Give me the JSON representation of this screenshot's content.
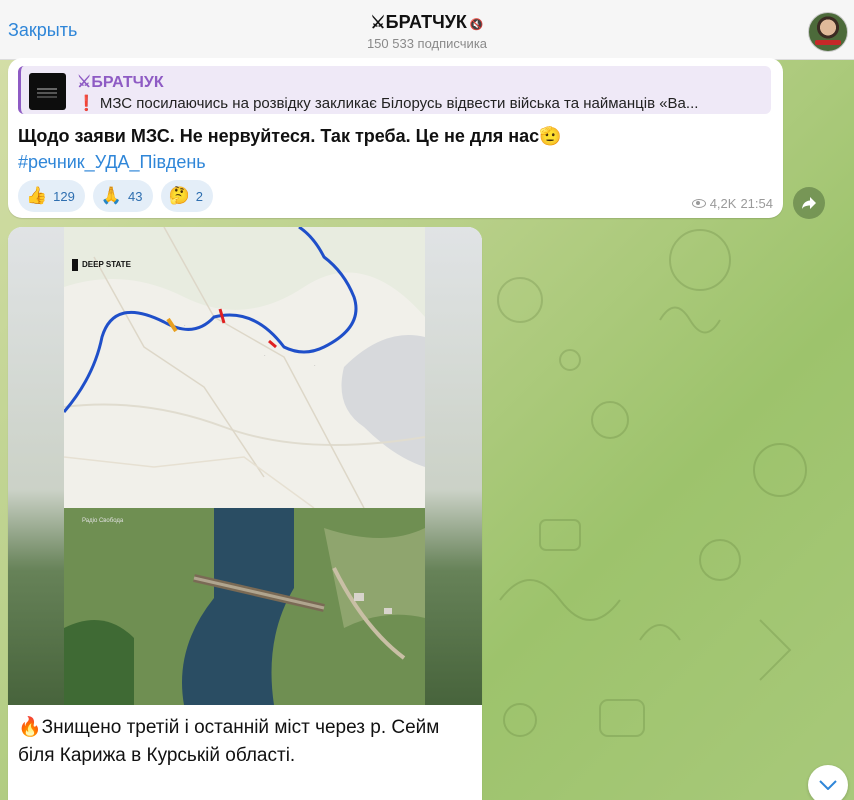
{
  "header": {
    "close_label": "Закрыть",
    "channel_name": "БРАТЧУК",
    "channel_prefix_icon": "crossed-swords-icon",
    "muted_icon": "muted-speaker-icon",
    "subscribers": "150 533 подписчика"
  },
  "message1": {
    "reply": {
      "name": "БРАТЧУК",
      "text": "МЗС посилаючись на розвідку закликає Білорусь відвести війська та найманців «Ва..."
    },
    "text": "Щодо заяви МЗС. Не нервуйтеся. Так треба. Це не для нас",
    "text_emoji": "🫡",
    "hashtag": "#речник_УДА_Південь",
    "reactions": [
      {
        "emoji": "👍",
        "count": "129"
      },
      {
        "emoji": "🙏",
        "count": "43"
      },
      {
        "emoji": "🤔",
        "count": "2"
      }
    ],
    "views": "4,2K",
    "time": "21:54"
  },
  "message2": {
    "map_brand": "DEEP STATE",
    "sat_brand": "Радіо Свобода",
    "caption_emoji": "🔥",
    "caption": "Знищено третій і останній міст через р. Сейм біля Карижа в Курській області."
  },
  "colors": {
    "accent": "#2f86d8",
    "reply_accent": "#8e5bc4",
    "river": "#1f4fc9",
    "strike": "#e02020"
  }
}
